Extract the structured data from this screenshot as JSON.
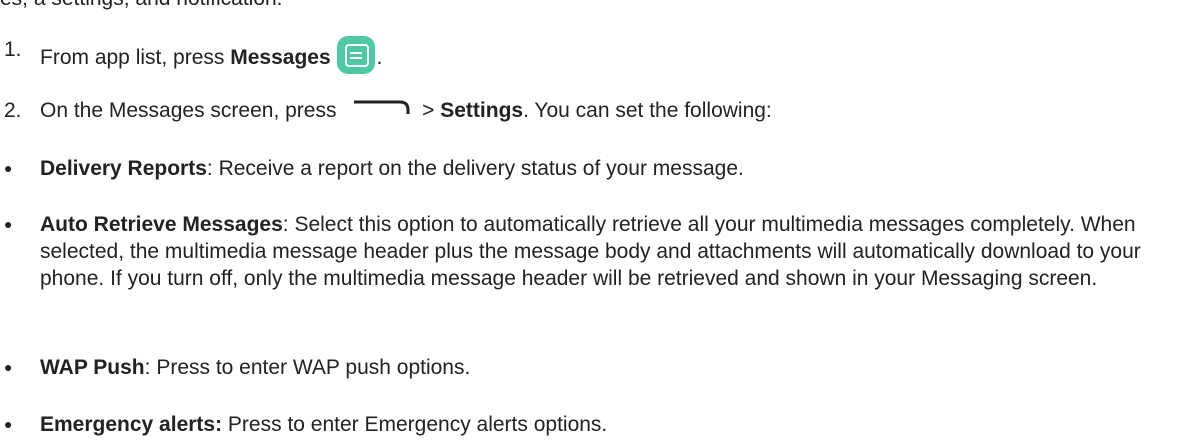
{
  "top_partial": "es, a settings, and notification.",
  "steps": [
    {
      "number": "1.",
      "pre": "From app list, press ",
      "bold": "Messages",
      "post": "."
    },
    {
      "number": "2.",
      "pre": "On the Messages screen, press ",
      "mid": " > ",
      "bold": "Settings",
      "post": ". You can set the following:"
    }
  ],
  "bullets": [
    {
      "term": "Delivery Reports",
      "sep": ":",
      "desc": " Receive a report on the delivery status of your message."
    },
    {
      "term": "Auto Retrieve Messages",
      "sep": ":",
      "desc": " Select this option to automatically retrieve all your multimedia messages completely. When selected, the multimedia message header plus the message body and attachments will automatically download to your phone. If you turn off, only the multimedia message header will be retrieved and shown in your Messaging screen."
    },
    {
      "term": "WAP Push",
      "sep": ":",
      "desc": " Press to enter WAP push options."
    },
    {
      "term": "Emergency alerts:",
      "sep": "",
      "desc": " Press to enter Emergency alerts options."
    }
  ],
  "bullet_glyph": "●",
  "icons": {
    "messages_app": "messages-app-icon",
    "menu": "menu-icon",
    "messages_color": "#4fc8a6"
  }
}
